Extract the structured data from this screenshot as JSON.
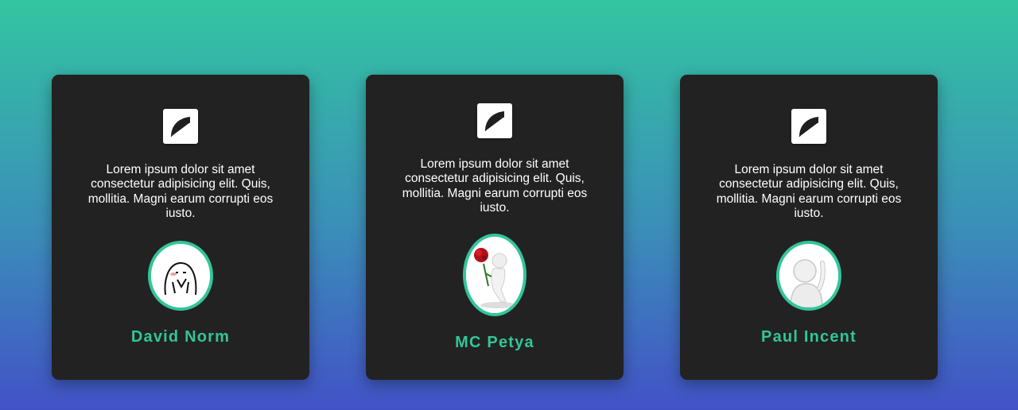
{
  "cards": [
    {
      "quote_icon": "quote-icon",
      "text": "Lorem ipsum dolor sit amet consectetur adipisicing elit. Quis, mollitia. Magni earum corrupti eos iusto.",
      "avatar_icon": "doodle-face-avatar",
      "name": "David Norm"
    },
    {
      "quote_icon": "quote-icon",
      "text": "Lorem ipsum dolor sit amet consectetur adipisicing elit. Quis, mollitia. Magni earum corrupti eos iusto.",
      "avatar_icon": "figure-with-rose-avatar",
      "name": "MC Petya"
    },
    {
      "quote_icon": "quote-icon",
      "text": "Lorem ipsum dolor sit amet consectetur adipisicing elit. Quis, mollitia. Magni earum corrupti eos iusto.",
      "avatar_icon": "figure-thinking-avatar",
      "name": "Paul Incent"
    }
  ],
  "colors": {
    "accent": "#33c59a",
    "card_bg": "#222222",
    "gradient_top": "#33c5a0",
    "gradient_bottom": "#4252c6"
  }
}
